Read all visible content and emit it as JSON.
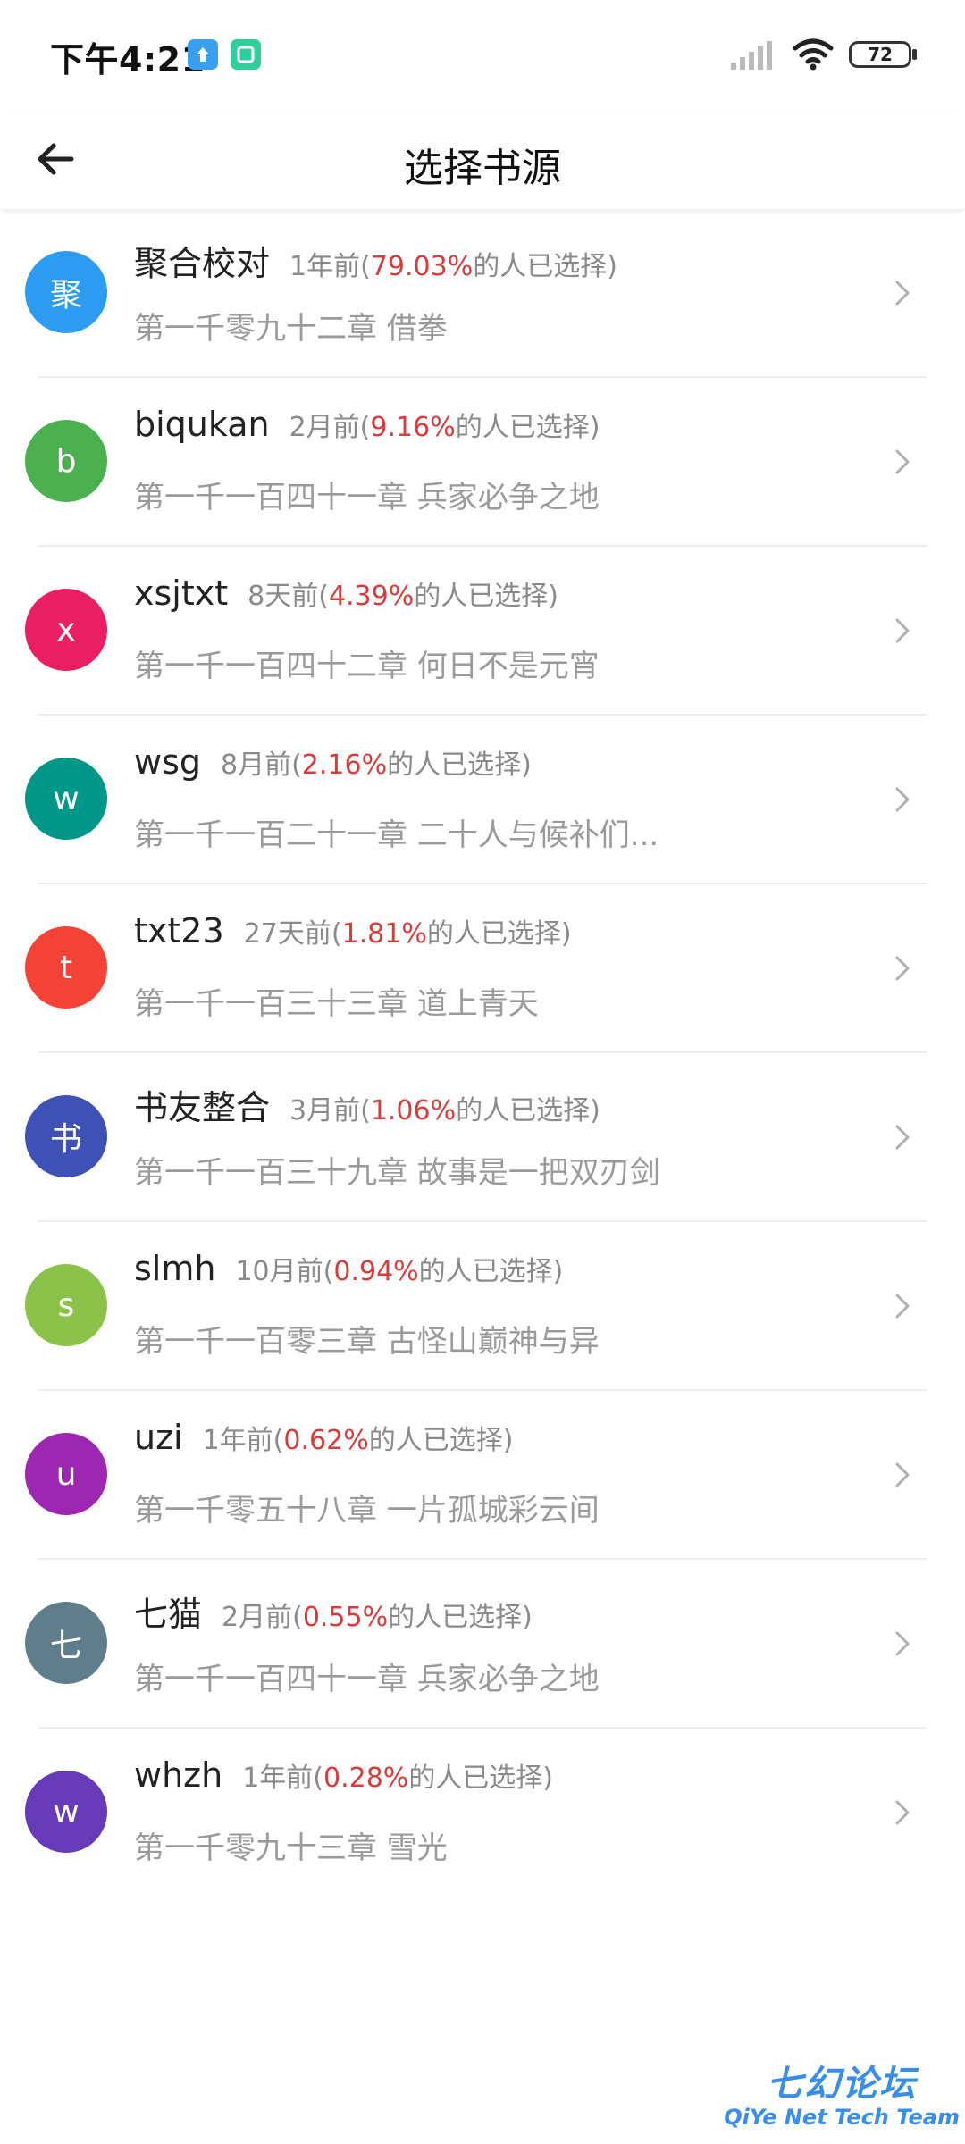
{
  "status_bar": {
    "time": "下午4:21",
    "battery": "72"
  },
  "header": {
    "title": "选择书源"
  },
  "sources": [
    {
      "initial": "聚",
      "name": "聚合校对",
      "time": "1年前(",
      "percent": "79.03%",
      "suffix": "的人已选择)",
      "chapter": "第一千零九十二章 借拳",
      "color": "#2d9cf0"
    },
    {
      "initial": "b",
      "name": "biqukan",
      "time": "2月前(",
      "percent": "9.16%",
      "suffix": "的人已选择)",
      "chapter": "第一千一百四十一章 兵家必争之地",
      "color": "#4caf50"
    },
    {
      "initial": "x",
      "name": "xsjtxt",
      "time": "8天前(",
      "percent": "4.39%",
      "suffix": "的人已选择)",
      "chapter": "第一千一百四十二章 何日不是元宵",
      "color": "#e91e63"
    },
    {
      "initial": "w",
      "name": "wsg",
      "time": "8月前(",
      "percent": "2.16%",
      "suffix": "的人已选择)",
      "chapter": "第一千一百二十一章 二十人与候补们...",
      "color": "#009688"
    },
    {
      "initial": "t",
      "name": "txt23",
      "time": "27天前(",
      "percent": "1.81%",
      "suffix": "的人已选择)",
      "chapter": "第一千一百三十三章 道上青天",
      "color": "#f44336"
    },
    {
      "initial": "书",
      "name": "书友整合",
      "time": "3月前(",
      "percent": "1.06%",
      "suffix": "的人已选择)",
      "chapter": "第一千一百三十九章 故事是一把双刃剑",
      "color": "#3f51b5"
    },
    {
      "initial": "s",
      "name": "slmh",
      "time": "10月前(",
      "percent": "0.94%",
      "suffix": "的人已选择)",
      "chapter": "第一千一百零三章 古怪山巅神与异",
      "color": "#8bc34a"
    },
    {
      "initial": "u",
      "name": "uzi",
      "time": "1年前(",
      "percent": "0.62%",
      "suffix": "的人已选择)",
      "chapter": "第一千零五十八章 一片孤城彩云间",
      "color": "#9c27b0"
    },
    {
      "initial": "七",
      "name": "七猫",
      "time": "2月前(",
      "percent": "0.55%",
      "suffix": "的人已选择)",
      "chapter": "第一千一百四十一章 兵家必争之地",
      "color": "#607d8b"
    },
    {
      "initial": "w",
      "name": "whzh",
      "time": "1年前(",
      "percent": "0.28%",
      "suffix": "的人已选择)",
      "chapter": "第一千零九十三章 雪光",
      "color": "#673ab7"
    }
  ],
  "watermark": {
    "title": "七幻论坛",
    "subtitle": "QiYe Net Tech Team"
  },
  "colors": {
    "accent_percent": "#d83b3b",
    "meta_gray": "#8a8a8a"
  }
}
